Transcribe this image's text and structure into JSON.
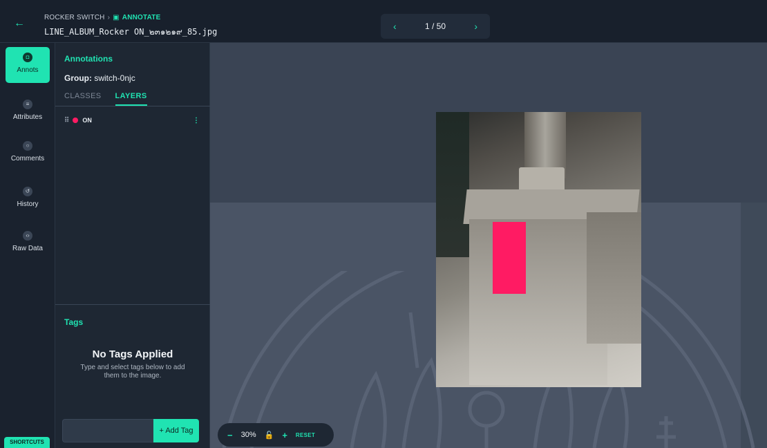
{
  "header": {
    "back_icon": "arrow-left-icon",
    "breadcrumb_project": "ROCKER SWITCH",
    "breadcrumb_separator": "›",
    "breadcrumb_current": "ANNOTATE",
    "breadcrumb_current_icon": "annotate-icon",
    "filename": "LINE_ALBUM_Rocker ON_๒๓๑๒๑๙_85.jpg"
  },
  "pager": {
    "prev_icon": "chevron-left-icon",
    "label": "1 / 50",
    "next_icon": "chevron-right-icon"
  },
  "rail": {
    "items": [
      {
        "label": "Annots",
        "icon": "annotation-icon",
        "active": true
      },
      {
        "label": "Attributes",
        "icon": "list-icon",
        "active": false
      },
      {
        "label": "Comments",
        "icon": "comment-icon",
        "active": false
      },
      {
        "label": "History",
        "icon": "history-icon",
        "active": false
      },
      {
        "label": "Raw Data",
        "icon": "code-icon",
        "active": false
      }
    ],
    "shortcuts_label": "SHORTCUTS"
  },
  "panel": {
    "title": "Annotations",
    "group_label": "Group:",
    "group_value": "switch-0njc",
    "tabs": [
      {
        "label": "CLASSES",
        "active": false
      },
      {
        "label": "LAYERS",
        "active": true
      }
    ],
    "layers": [
      {
        "name": "ON",
        "color": "#ff1b63"
      }
    ]
  },
  "tags": {
    "title": "Tags",
    "empty_title": "No Tags Applied",
    "empty_subtitle": "Type and select tags below to add them to the image.",
    "input_value": "",
    "add_button_label": "+ Add Tag"
  },
  "canvas": {
    "annotation_label": "ON",
    "annotation_color": "#ff1b63"
  },
  "zoom": {
    "minus": "−",
    "value": "30%",
    "plus": "+",
    "reset_label": "RESET"
  },
  "colors": {
    "accent": "#20e3b2",
    "background": "#1c2430"
  }
}
